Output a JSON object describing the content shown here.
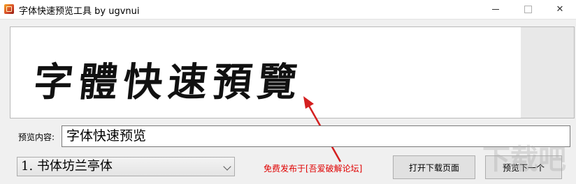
{
  "window": {
    "title": "字体快速预览工具 by ugvnui",
    "minimize_label": "—",
    "maximize_label": "",
    "close_label": "✕"
  },
  "preview": {
    "text": "字體快速預覽"
  },
  "form": {
    "label": "预览内容:",
    "input_value": "字体快速预览",
    "font_select_value": "1. 书体坊兰亭体"
  },
  "notice": "免费发布于[吾爱破解论坛]",
  "buttons": {
    "open_download": "打开下载页面",
    "next_preview": "预览下一个"
  },
  "watermark": "下载吧",
  "colors": {
    "notice": "#e00000",
    "arrow": "#d42020"
  }
}
